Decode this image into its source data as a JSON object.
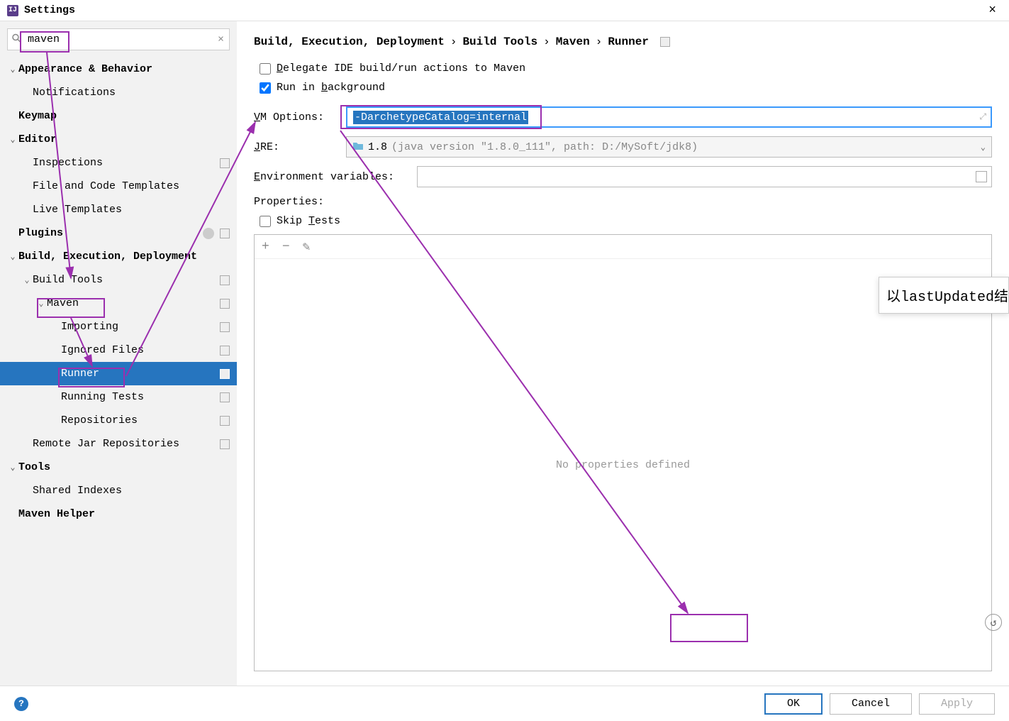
{
  "titlebar": {
    "title": "Settings",
    "close": "×"
  },
  "search": {
    "value": "maven"
  },
  "tree": [
    {
      "label": "Appearance & Behavior",
      "level": 0,
      "bold": true,
      "expand": true,
      "badges": 0
    },
    {
      "label": "Notifications",
      "level": 1,
      "bold": false,
      "badges": 0
    },
    {
      "label": "Keymap",
      "level": 0,
      "bold": true,
      "badges": 0
    },
    {
      "label": "Editor",
      "level": 0,
      "bold": true,
      "expand": true,
      "badges": 0
    },
    {
      "label": "Inspections",
      "level": 1,
      "bold": false,
      "badges": 1
    },
    {
      "label": "File and Code Templates",
      "level": 1,
      "bold": false,
      "badges": 0
    },
    {
      "label": "Live Templates",
      "level": 1,
      "bold": false,
      "badges": 0
    },
    {
      "label": "Plugins",
      "level": 0,
      "bold": true,
      "badges": 1,
      "circle": true
    },
    {
      "label": "Build, Execution, Deployment",
      "level": 0,
      "bold": true,
      "expand": true,
      "badges": 0
    },
    {
      "label": "Build Tools",
      "level": 1,
      "bold": false,
      "expand": true,
      "badges": 1
    },
    {
      "label": "Maven",
      "level": 2,
      "bold": false,
      "expand": true,
      "badges": 1
    },
    {
      "label": "Importing",
      "level": 3,
      "bold": false,
      "badges": 1
    },
    {
      "label": "Ignored Files",
      "level": 3,
      "bold": false,
      "badges": 1
    },
    {
      "label": "Runner",
      "level": 3,
      "bold": false,
      "badges": 1,
      "selected": true
    },
    {
      "label": "Running Tests",
      "level": 3,
      "bold": false,
      "badges": 1
    },
    {
      "label": "Repositories",
      "level": 3,
      "bold": false,
      "badges": 1
    },
    {
      "label": "Remote Jar Repositories",
      "level": 1,
      "bold": false,
      "badges": 1
    },
    {
      "label": "Tools",
      "level": 0,
      "bold": true,
      "expand": true,
      "badges": 0
    },
    {
      "label": "Shared Indexes",
      "level": 1,
      "bold": false,
      "badges": 0
    },
    {
      "label": "Maven Helper",
      "level": 0,
      "bold": true,
      "badges": 0
    }
  ],
  "breadcrumb": [
    "Build, Execution, Deployment",
    "Build Tools",
    "Maven",
    "Runner"
  ],
  "form": {
    "delegate_label": "Delegate IDE build/run actions to Maven",
    "delegate_checked": false,
    "background_prefix": "Run in ",
    "background_underlined": "b",
    "background_suffix": "ackground",
    "background_checked": true,
    "vm_label_u": "V",
    "vm_label_rest": "M Options:",
    "vm_value": "-DarchetypeCatalog=internal",
    "jre_label_u": "J",
    "jre_label_rest": "RE:",
    "jre_version": "1.8",
    "jre_detail": "(java version \"1.8.0_111\", path: D:/MySoft/jdk8)",
    "env_label_u": "E",
    "env_label_rest": "nvironment variables:",
    "props_label": "Properties:",
    "skip_prefix": "Skip ",
    "skip_u": "T",
    "skip_suffix": "ests",
    "skip_checked": false,
    "empty_props": "No properties defined"
  },
  "tooltip_fragment": "以lastUpdated结",
  "footer": {
    "ok": "OK",
    "cancel": "Cancel",
    "apply": "Apply"
  }
}
